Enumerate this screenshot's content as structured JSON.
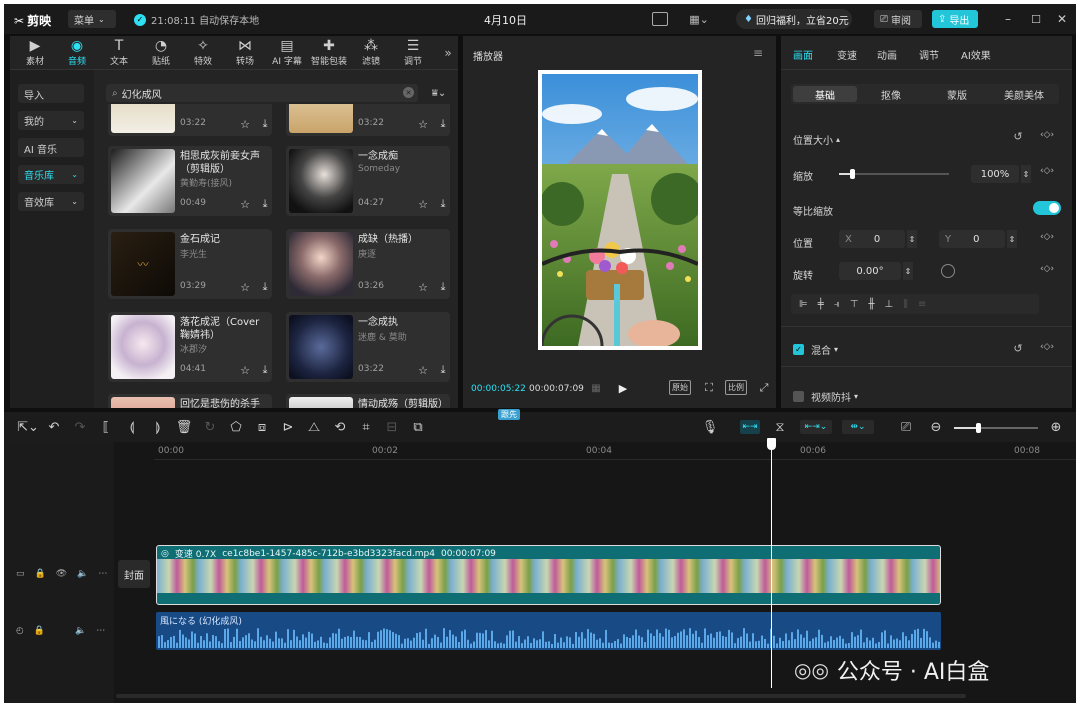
{
  "app": {
    "logo": "剪映",
    "menu_label": "菜单",
    "save_status": "21:08:11 自动保存本地",
    "project_title": "4月10日",
    "promo_label": "回归福利，立省20元",
    "review_label": "审阅",
    "export_label": "导出"
  },
  "media_tabs": [
    {
      "label": "素材",
      "icon": "media-icon"
    },
    {
      "label": "音频",
      "icon": "audio-icon"
    },
    {
      "label": "文本",
      "icon": "text-icon"
    },
    {
      "label": "贴纸",
      "icon": "sticker-icon"
    },
    {
      "label": "特效",
      "icon": "effects-icon"
    },
    {
      "label": "转场",
      "icon": "transition-icon"
    },
    {
      "label": "AI 字幕",
      "icon": "subtitle-icon"
    },
    {
      "label": "智能包装",
      "icon": "package-icon"
    },
    {
      "label": "滤镜",
      "icon": "filter-icon"
    },
    {
      "label": "调节",
      "icon": "adjust-icon"
    }
  ],
  "sidebar": [
    {
      "label": "导入"
    },
    {
      "label": "我的"
    },
    {
      "label": "AI 音乐"
    },
    {
      "label": "音乐库"
    },
    {
      "label": "音效库"
    }
  ],
  "search": {
    "value": "幻化成风"
  },
  "songs": [
    {
      "title": "",
      "artist": "",
      "time": "03:22"
    },
    {
      "title": "",
      "artist": "",
      "time": "03:22"
    },
    {
      "title": "相思成灰前妾女声（剪辑版）",
      "artist": "黄勤寿(接风)",
      "time": "00:49"
    },
    {
      "title": "一念成痴",
      "artist": "Someday",
      "time": "04:27"
    },
    {
      "title": "金石成记",
      "artist": "李光生",
      "time": "03:29"
    },
    {
      "title": "成缺（热播）",
      "artist": "庚逐",
      "time": "03:26"
    },
    {
      "title": "落花成泥（Cover 鞠婧祎）",
      "artist": "冰郡汐",
      "time": "04:41"
    },
    {
      "title": "一念成执",
      "artist": "迷鹿 & 莫助",
      "time": "03:22"
    },
    {
      "title": "回忆是悲伤的杀手锏",
      "artist": "",
      "time": ""
    },
    {
      "title": "情动成殇（剪辑版）",
      "artist": "",
      "time": ""
    }
  ],
  "player": {
    "title": "播放器",
    "current_time": "00:00:05:22",
    "total_time": "00:00:07:09",
    "btn_fit": "原始",
    "btn_ratio": "比例"
  },
  "inspector": {
    "tabs": [
      "画面",
      "变速",
      "动画",
      "调节",
      "AI效果"
    ],
    "subtabs": [
      "基础",
      "抠像",
      "蒙版",
      "美颜美体"
    ],
    "section_position_size": "位置大小",
    "scale_label": "缩放",
    "scale_value": "100%",
    "scale_fraction": 0.12,
    "uniform_scale_label": "等比缩放",
    "position_label": "位置",
    "x_label": "X",
    "x_value": "0",
    "y_label": "Y",
    "y_value": "0",
    "rotate_label": "旋转",
    "rotate_value": "0.00°",
    "blend_label": "混合",
    "stabilize_label": "视频防抖"
  },
  "timeline": {
    "ruler": [
      "00:00",
      "00:02",
      "00:04",
      "00:06",
      "00:08"
    ],
    "first_badge": "跟先",
    "cover_label": "封面",
    "video_clip": {
      "speed": "变速 0.7X",
      "name": "ce1c8be1-1457-485c-712b-e3bd3323facd.mp4",
      "duration": "00:00:07:09"
    },
    "audio_clip": {
      "name": "風になる (幻化成风)"
    }
  },
  "watermark": "公众号 · AI白盒",
  "colors": {
    "accent": "#2ee0f2",
    "video_track": "#0e6e74",
    "audio_track": "#184a86"
  }
}
